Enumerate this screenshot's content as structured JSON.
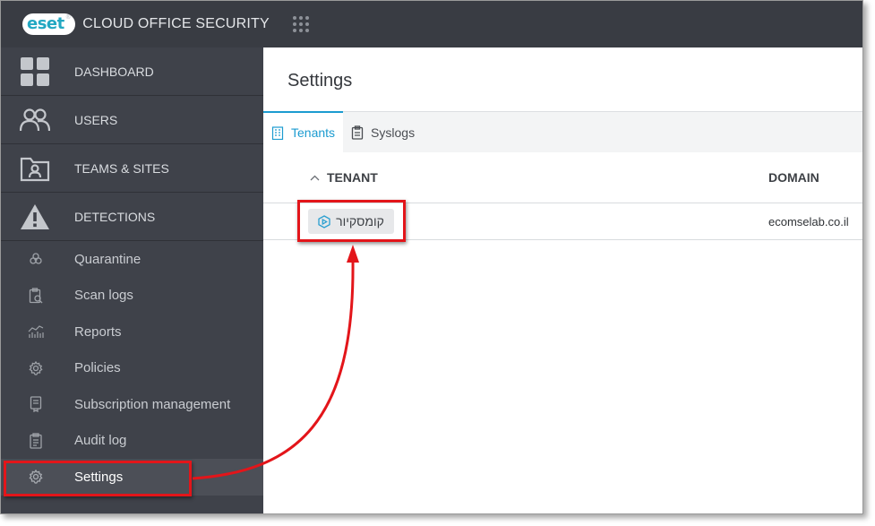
{
  "topbar": {
    "logo_text": "eset",
    "logo_reg": "®",
    "product_title": "CLOUD OFFICE SECURITY"
  },
  "sidebar": {
    "main_items": [
      {
        "label": "DASHBOARD",
        "icon": "dashboard-grid-icon"
      },
      {
        "label": "USERS",
        "icon": "users-icon"
      },
      {
        "label": "TEAMS & SITES",
        "icon": "teams-sites-folder-icon"
      },
      {
        "label": "DETECTIONS",
        "icon": "warning-triangle-icon"
      }
    ],
    "sub_items": [
      {
        "label": "Quarantine",
        "icon": "biohazard-icon"
      },
      {
        "label": "Scan logs",
        "icon": "scan-logs-icon"
      },
      {
        "label": "Reports",
        "icon": "reports-chart-icon"
      },
      {
        "label": "Policies",
        "icon": "policies-gear-icon"
      },
      {
        "label": "Subscription management",
        "icon": "subscription-icon"
      },
      {
        "label": "Audit log",
        "icon": "audit-clipboard-icon"
      },
      {
        "label": "Settings",
        "icon": "settings-gear-icon",
        "active": true
      }
    ]
  },
  "main": {
    "page_title": "Settings",
    "tabs": [
      {
        "label": "Tenants",
        "icon": "tenants-building-icon",
        "active": true
      },
      {
        "label": "Syslogs",
        "icon": "syslogs-clipboard-icon"
      }
    ],
    "table": {
      "columns": [
        "TENANT",
        "DOMAIN"
      ],
      "rows": [
        {
          "tenant": "קומסקיור",
          "domain": "ecomselab.co.il"
        }
      ]
    }
  },
  "colors": {
    "topbar_bg": "#393c43",
    "sidebar_bg": "#3f424a",
    "accent": "#1c9bd0",
    "highlight": "#e3151a"
  }
}
